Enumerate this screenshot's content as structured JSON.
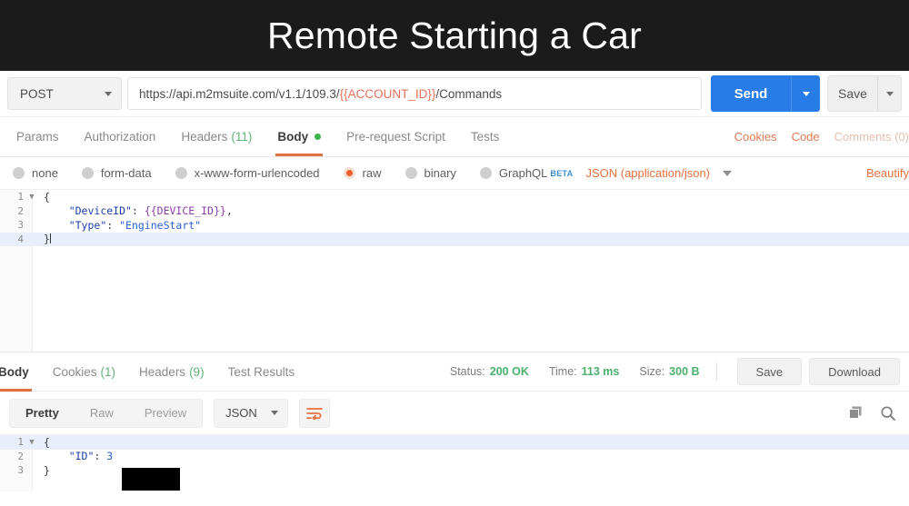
{
  "banner": {
    "title": "Remote Starting a Car",
    "bg": "#1b1b1b",
    "fg": "#ffffff"
  },
  "request": {
    "method": "POST",
    "url_prefix": "https://api.m2msuite.com/v1.1/109.3/",
    "url_variable": "{{ACCOUNT_ID}}",
    "url_suffix": "/Commands",
    "url_variable_color": "#e8705a",
    "send_label": "Send",
    "save_label": "Save",
    "send_color": "#287ce8",
    "tabs": [
      {
        "label": "Params",
        "count": "",
        "active": false
      },
      {
        "label": "Authorization",
        "count": "",
        "active": false
      },
      {
        "label": "Headers",
        "count": "(11)",
        "active": false
      },
      {
        "label": "Body",
        "count": "",
        "active": true
      },
      {
        "label": "Pre-request Script",
        "count": "",
        "active": false
      },
      {
        "label": "Tests",
        "count": "",
        "active": false
      }
    ],
    "tab_links": [
      {
        "label": "Cookies",
        "muted": false
      },
      {
        "label": "Code",
        "muted": false
      },
      {
        "label": "Comments (0)",
        "muted": true
      }
    ],
    "body_types": [
      {
        "label": "none",
        "selected": false
      },
      {
        "label": "form-data",
        "selected": false
      },
      {
        "label": "x-www-form-urlencoded",
        "selected": false
      },
      {
        "label": "raw",
        "selected": true
      },
      {
        "label": "binary",
        "selected": false
      },
      {
        "label": "GraphQL",
        "selected": false,
        "badge": "BETA"
      }
    ],
    "content_type": "JSON (application/json)",
    "beautify_label": "Beautify",
    "accent_color": "#e8713f",
    "editor_lines": [
      {
        "num": "1",
        "fold": true,
        "active": false,
        "tokens": [
          {
            "t": "{",
            "c": "punct"
          }
        ]
      },
      {
        "num": "2",
        "fold": false,
        "active": false,
        "tokens": [
          {
            "t": "    ",
            "c": "punct"
          },
          {
            "t": "\"DeviceID\"",
            "c": "key"
          },
          {
            "t": ": ",
            "c": "punct"
          },
          {
            "t": "{{DEVICE_ID}}",
            "c": "var"
          },
          {
            "t": ",",
            "c": "punct"
          }
        ]
      },
      {
        "num": "3",
        "fold": false,
        "active": false,
        "tokens": [
          {
            "t": "    ",
            "c": "punct"
          },
          {
            "t": "\"Type\"",
            "c": "key"
          },
          {
            "t": ": ",
            "c": "punct"
          },
          {
            "t": "\"EngineStart\"",
            "c": "str"
          }
        ]
      },
      {
        "num": "4",
        "fold": false,
        "active": true,
        "tokens": [
          {
            "t": "}",
            "c": "punct"
          }
        ]
      }
    ]
  },
  "response": {
    "tabs": [
      {
        "label": "Body",
        "count": "",
        "active": true
      },
      {
        "label": "Cookies",
        "count": "(1)",
        "active": false
      },
      {
        "label": "Headers",
        "count": "(9)",
        "active": false
      },
      {
        "label": "Test Results",
        "count": "",
        "active": false
      }
    ],
    "status_label": "Status:",
    "status_value": "200 OK",
    "time_label": "Time:",
    "time_value": "113 ms",
    "size_label": "Size:",
    "size_value": "300 B",
    "status_color": "#4caf6d",
    "save_label": "Save",
    "download_label": "Download",
    "view_modes": [
      {
        "label": "Pretty",
        "active": true
      },
      {
        "label": "Raw",
        "active": false
      },
      {
        "label": "Preview",
        "active": false
      }
    ],
    "format": "JSON",
    "editor_lines": [
      {
        "num": "1",
        "fold": true,
        "active": true,
        "tokens": [
          {
            "t": "{",
            "c": "punct"
          }
        ]
      },
      {
        "num": "2",
        "fold": false,
        "active": false,
        "tokens": [
          {
            "t": "    ",
            "c": "punct"
          },
          {
            "t": "\"ID\"",
            "c": "key"
          },
          {
            "t": ": ",
            "c": "punct"
          },
          {
            "t": "3",
            "c": "str"
          }
        ]
      },
      {
        "num": "3",
        "fold": false,
        "active": false,
        "tokens": [
          {
            "t": "}",
            "c": "punct"
          }
        ]
      }
    ],
    "redacted": true
  }
}
